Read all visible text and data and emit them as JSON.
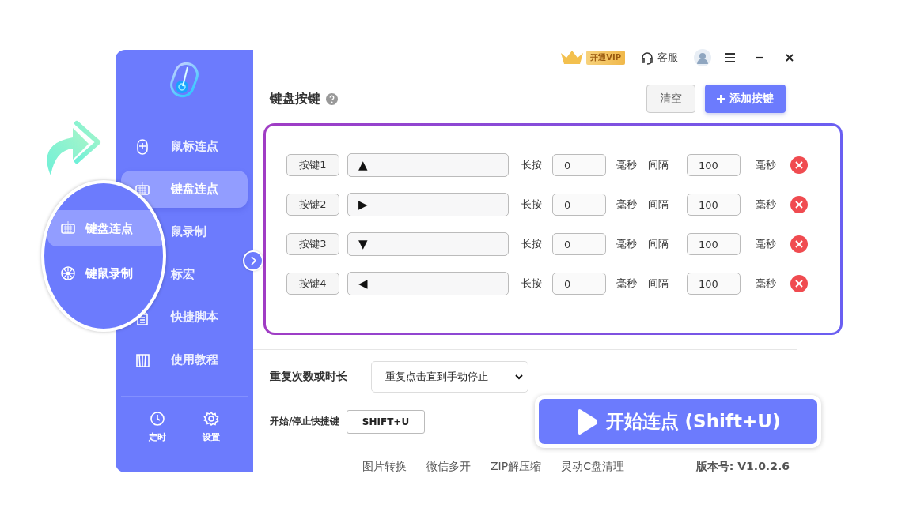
{
  "topbar": {
    "vip_badge": "开通VIP",
    "service": "客服"
  },
  "sidebar": {
    "items": [
      {
        "label": "鼠标连点",
        "selected": false
      },
      {
        "label": "键盘连点",
        "selected": true
      },
      {
        "label": "鼠录制",
        "selected": false
      },
      {
        "label": "标宏",
        "selected": false
      },
      {
        "label": "快捷脚本",
        "selected": false
      },
      {
        "label": "使用教程",
        "selected": false
      }
    ],
    "bottom": [
      {
        "label": "定时"
      },
      {
        "label": "设置"
      }
    ]
  },
  "magnifier": {
    "items": [
      {
        "label": "键盘连点",
        "selected": true
      },
      {
        "label": "键鼠录制",
        "selected": false
      }
    ]
  },
  "header": {
    "title": "键盘按键",
    "clear_button": "清空",
    "add_button": "添加按键"
  },
  "keys": [
    {
      "name": "按键1",
      "key": "▲",
      "hold_label": "长按",
      "hold": "0",
      "hold_unit": "毫秒",
      "interval_label": "间隔",
      "interval": "100",
      "interval_unit": "毫秒"
    },
    {
      "name": "按键2",
      "key": "▶",
      "hold_label": "长按",
      "hold": "0",
      "hold_unit": "毫秒",
      "interval_label": "间隔",
      "interval": "100",
      "interval_unit": "毫秒"
    },
    {
      "name": "按键3",
      "key": "▼",
      "hold_label": "长按",
      "hold": "0",
      "hold_unit": "毫秒",
      "interval_label": "间隔",
      "interval": "100",
      "interval_unit": "毫秒"
    },
    {
      "name": "按键4",
      "key": "◀",
      "hold_label": "长按",
      "hold": "0",
      "hold_unit": "毫秒",
      "interval_label": "间隔",
      "interval": "100",
      "interval_unit": "毫秒"
    }
  ],
  "repeat": {
    "label": "重复次数或时长",
    "value": "重复点击直到手动停止"
  },
  "hotkey": {
    "label": "开始/停止快捷键",
    "value": "SHIFT+U"
  },
  "start_button": "开始连点 (Shift+U)",
  "footer": {
    "links": [
      "图片转换",
      "微信多开",
      "ZIP解压缩",
      "灵动C盘清理"
    ],
    "version": "版本号: V1.0.2.6"
  }
}
